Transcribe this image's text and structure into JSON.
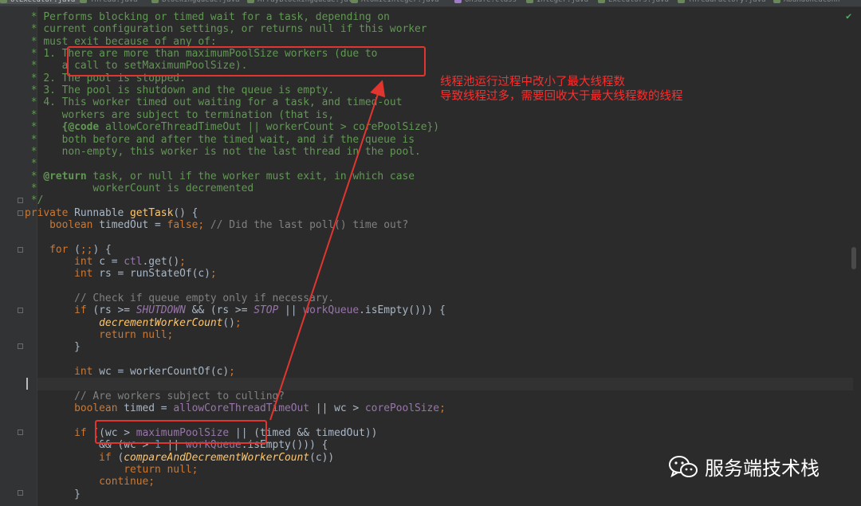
{
  "tabs": [
    {
      "label": "olExecutor.java",
      "kind": "java",
      "active": true
    },
    {
      "label": "Thread.java",
      "kind": "java"
    },
    {
      "label": "BlockingQueue.java",
      "kind": "java"
    },
    {
      "label": "ArrayBlockingQueue.java",
      "kind": "java"
    },
    {
      "label": "AtomicInteger.java",
      "kind": "java"
    },
    {
      "label": "Unsafe.class",
      "kind": "class"
    },
    {
      "label": "Integer.java",
      "kind": "java"
    },
    {
      "label": "Executors.java",
      "kind": "java"
    },
    {
      "label": "ThreadFactory.java",
      "kind": "java"
    },
    {
      "label": "AbandonedConn",
      "kind": "java"
    }
  ],
  "code_lines": [
    {
      "p": [
        [
          "doc",
          "     * Performs blocking or timed wait for a task, depending on"
        ]
      ]
    },
    {
      "p": [
        [
          "doc",
          "     * current configuration settings, or returns null if this worker"
        ]
      ]
    },
    {
      "p": [
        [
          "doc",
          "     * must exit because of any of:"
        ]
      ]
    },
    {
      "p": [
        [
          "doc",
          "     * 1. There are more than maximumPoolSize workers (due to"
        ]
      ]
    },
    {
      "p": [
        [
          "doc",
          "     *    a call to setMaximumPoolSize)."
        ]
      ]
    },
    {
      "p": [
        [
          "doc",
          "     * 2. The pool is stopped."
        ]
      ]
    },
    {
      "p": [
        [
          "doc",
          "     * 3. The pool is shutdown and the queue is empty."
        ]
      ]
    },
    {
      "p": [
        [
          "doc",
          "     * 4. This worker timed out waiting for a task, and timed-out"
        ]
      ]
    },
    {
      "p": [
        [
          "doc",
          "     *    workers are subject to termination (that is,"
        ]
      ]
    },
    {
      "p": [
        [
          "doc",
          "     *    "
        ],
        [
          "dtag",
          "{@code"
        ],
        [
          "doc",
          " allowCoreThreadTimeOut || workerCount > corePoolSize})"
        ]
      ]
    },
    {
      "p": [
        [
          "doc",
          "     *    both before and after the timed wait, and if the queue is"
        ]
      ]
    },
    {
      "p": [
        [
          "doc",
          "     *    non-empty, this worker is not the last thread in the pool."
        ]
      ]
    },
    {
      "p": [
        [
          "doc",
          "     *"
        ]
      ]
    },
    {
      "p": [
        [
          "doc",
          "     * "
        ],
        [
          "dtag",
          "@return"
        ],
        [
          "doc",
          " task, or null if the worker must exit, in which case"
        ]
      ]
    },
    {
      "p": [
        [
          "doc",
          "     *         workerCount is decremented"
        ]
      ]
    },
    {
      "p": [
        [
          "doc",
          "     */"
        ]
      ]
    },
    {
      "p": [
        [
          "kw",
          "    private "
        ],
        [
          "",
          "Runnable "
        ],
        [
          "fn",
          "getTask"
        ],
        [
          "",
          "() {"
        ]
      ]
    },
    {
      "p": [
        [
          "kw",
          "        boolean "
        ],
        [
          "",
          "timedOut = "
        ],
        [
          "kw",
          "false"
        ],
        [
          "kw",
          "; "
        ],
        [
          "cm",
          "// Did the last poll() time out?"
        ]
      ]
    },
    {
      "p": [
        [
          "",
          ""
        ]
      ]
    },
    {
      "p": [
        [
          "kw",
          "        for "
        ],
        [
          "",
          "("
        ],
        [
          "kw",
          ";;"
        ],
        [
          "",
          ") {"
        ]
      ]
    },
    {
      "p": [
        [
          "kw",
          "            int "
        ],
        [
          "",
          "c = "
        ],
        [
          "fld",
          "ctl"
        ],
        [
          "",
          ".get()"
        ],
        [
          "kw",
          ";"
        ]
      ]
    },
    {
      "p": [
        [
          "kw",
          "            int "
        ],
        [
          "",
          "rs = runStateOf(c)"
        ],
        [
          "kw",
          ";"
        ]
      ]
    },
    {
      "p": [
        [
          "",
          ""
        ]
      ]
    },
    {
      "p": [
        [
          "cm",
          "            // Check if queue empty only if necessary."
        ]
      ]
    },
    {
      "p": [
        [
          "kw",
          "            if "
        ],
        [
          "",
          "(rs >= "
        ],
        [
          "fit",
          "SHUTDOWN"
        ],
        [
          "",
          " && (rs >= "
        ],
        [
          "fit",
          "STOP"
        ],
        [
          "",
          " || "
        ],
        [
          "fld",
          "workQueue"
        ],
        [
          "",
          ".isEmpty())) {"
        ]
      ]
    },
    {
      "p": [
        [
          "sfn",
          "                decrementWorkerCount"
        ],
        [
          "",
          "()"
        ],
        [
          "kw",
          ";"
        ]
      ]
    },
    {
      "p": [
        [
          "kw",
          "                return null;"
        ]
      ]
    },
    {
      "p": [
        [
          "",
          "            }"
        ]
      ]
    },
    {
      "p": [
        [
          "",
          ""
        ]
      ]
    },
    {
      "p": [
        [
          "kw",
          "            int "
        ],
        [
          "",
          "wc = workerCountOf(c)"
        ],
        [
          "kw",
          ";"
        ]
      ]
    },
    {
      "p": [
        [
          "",
          ""
        ]
      ]
    },
    {
      "p": [
        [
          "cm",
          "            // Are workers subject to culling?"
        ]
      ]
    },
    {
      "p": [
        [
          "kw",
          "            boolean "
        ],
        [
          "",
          "timed = "
        ],
        [
          "fld",
          "allowCoreThreadTimeOut"
        ],
        [
          "",
          " || wc > "
        ],
        [
          "fld",
          "corePoolSize"
        ],
        [
          "kw",
          ";"
        ]
      ]
    },
    {
      "p": [
        [
          "",
          ""
        ]
      ]
    },
    {
      "p": [
        [
          "kw",
          "            if "
        ],
        [
          "",
          "((wc > "
        ],
        [
          "fld",
          "maximumPoolSize"
        ],
        [
          "",
          " || (timed && timedOut))"
        ]
      ]
    },
    {
      "p": [
        [
          "",
          "                && (wc > "
        ],
        [
          "num",
          "1"
        ],
        [
          "",
          " || "
        ],
        [
          "fld",
          "workQueue"
        ],
        [
          "",
          ".isEmpty())) {"
        ]
      ]
    },
    {
      "p": [
        [
          "kw",
          "                if "
        ],
        [
          "",
          "("
        ],
        [
          "sfn",
          "compareAndDecrementWorkerCount"
        ],
        [
          "",
          "(c))"
        ]
      ]
    },
    {
      "p": [
        [
          "kw",
          "                    return null;"
        ]
      ]
    },
    {
      "p": [
        [
          "kw",
          "                continue;"
        ]
      ]
    },
    {
      "p": [
        [
          "",
          "            }"
        ]
      ]
    }
  ],
  "annotation": {
    "line1": "线程池运行过程中改小了最大线程数",
    "line2": "导致线程过多，需要回收大于最大线程数的线程",
    "color": "#ff2d2d"
  },
  "watermark": {
    "text": "服务端技术栈",
    "icon": "wechat-icon"
  },
  "status": {
    "check_icon": "✔"
  }
}
